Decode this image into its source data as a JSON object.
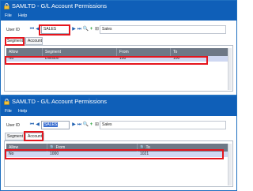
{
  "app": {
    "title": "SAMLTD - G/L Account Permissions",
    "menu": [
      "File",
      "Help"
    ],
    "user_id_label": "User ID",
    "user_id": "SALES",
    "user_description": "Sales"
  },
  "windows": [
    {
      "tabs": [
        "Segment",
        "Account"
      ],
      "active_tab": "Segment",
      "columns": [
        "Allow",
        "Segment",
        "From",
        "To"
      ],
      "row": [
        "No",
        "Division",
        "100",
        "100"
      ]
    },
    {
      "tabs": [
        "Segment",
        "Account"
      ],
      "active_tab": "Account",
      "columns": [
        "Allow",
        "From",
        "To"
      ],
      "row": [
        "No",
        "1000",
        "1021"
      ]
    }
  ],
  "colors": {
    "titlebar": "#0f5fb8",
    "highlight": "#e5151d",
    "selected_row": "#cfd8f2",
    "grid_header": "#6e7886"
  },
  "icons": [
    "lock-icon",
    "first-record-icon",
    "previous-record-icon",
    "next-record-icon",
    "last-record-icon",
    "finder-icon",
    "new-icon",
    "zoom-icon",
    "search-icon",
    "sort-icon"
  ]
}
